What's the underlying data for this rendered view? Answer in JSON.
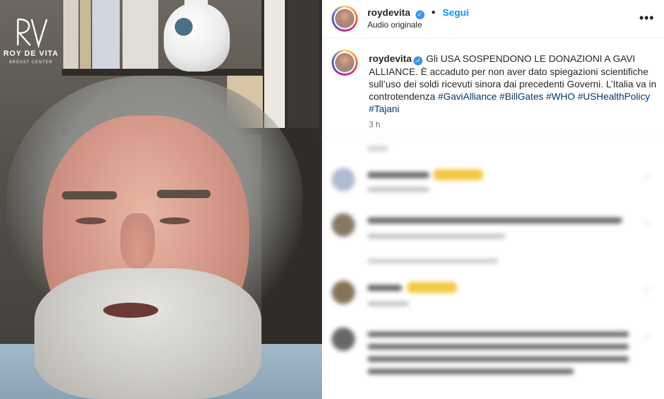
{
  "media": {
    "logo": {
      "name": "ROY DE VITA",
      "subtitle": "BREAST CENTER"
    }
  },
  "header": {
    "username": "roydevita",
    "separator": "•",
    "follow_label": "Segui",
    "audio_label": "Audio originale",
    "more_label": "•••"
  },
  "caption": {
    "username": "roydevita",
    "text": "Gli USA SOSPENDONO LE DONAZIONI A GAVI ALLIANCE. È accaduto per non aver dato spiegazioni scientifiche sull’uso dei soldi ricevuti sinora dai precedenti Governi. L’Italia va in controtendenza",
    "hashtags": [
      "#GaviAlliance",
      "#BillGates",
      "#WHO",
      "#USHealthPolicy",
      "#Tajani"
    ],
    "time": "3 h"
  },
  "comments": [
    {
      "username": "",
      "text": "",
      "meta": ""
    },
    {
      "username": "",
      "text": "",
      "meta": ""
    },
    {
      "username": "",
      "text": "",
      "meta": ""
    },
    {
      "username": "",
      "text": "",
      "meta": ""
    }
  ],
  "colors": {
    "follow": "#0095f6",
    "hashtag": "#00376b",
    "verified": "#3897f0"
  }
}
